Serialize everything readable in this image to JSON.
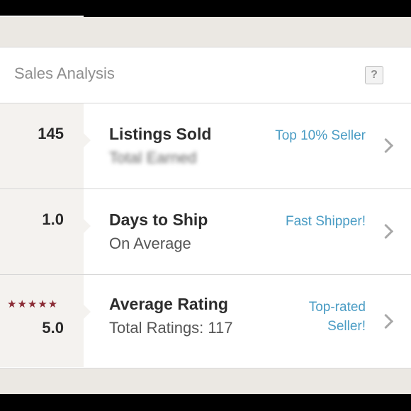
{
  "card": {
    "title": "Sales Analysis",
    "help": "?"
  },
  "rows": [
    {
      "value": "145",
      "title": "Listings Sold",
      "subtitle": "Total Earned",
      "badge": "Top 10% Seller"
    },
    {
      "value": "1.0",
      "title": "Days to Ship",
      "subtitle": "On Average",
      "badge": "Fast Shipper!"
    },
    {
      "value": "5.0",
      "stars": "★★★★★",
      "title": "Average Rating",
      "subtitle": "Total Ratings: 117",
      "badge": "Top-rated Seller!"
    }
  ],
  "colors": {
    "link": "#4a9cc4",
    "star": "#8a2b35"
  },
  "icons": {
    "help": "question-icon",
    "row_arrow": "chevron-right-icon"
  }
}
